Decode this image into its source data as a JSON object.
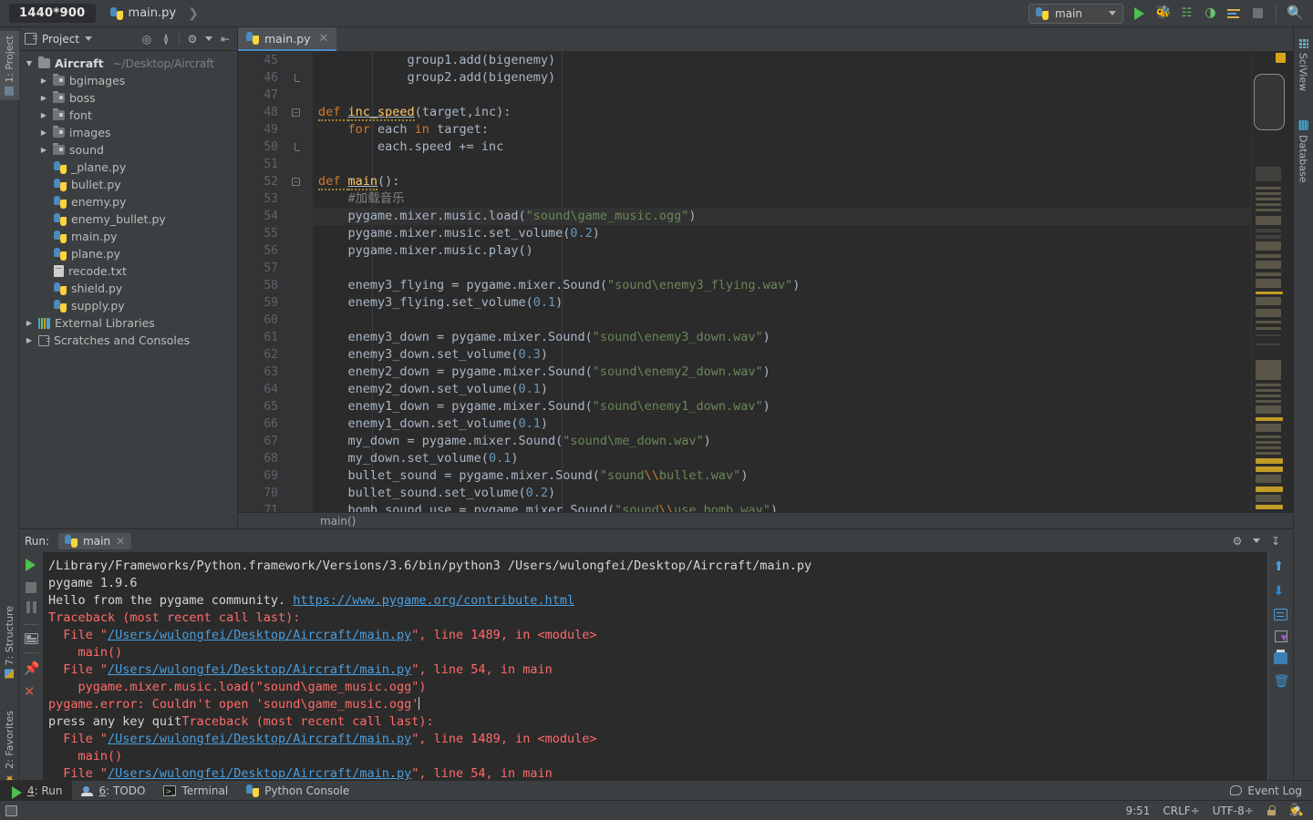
{
  "titlebar": {
    "resolution_badge": "1440*900",
    "breadcrumb_file": "main.py",
    "run_config": "main",
    "icons": [
      "run-icon",
      "debug-icon",
      "coverage-icon",
      "profile-icon",
      "console-icon",
      "stop-icon",
      "search-everywhere-icon"
    ]
  },
  "left_tool_strip": {
    "project_tab": "1: Project",
    "structure_tab": "7: Structure",
    "favorites_tab": "2: Favorites"
  },
  "right_tool_strip": {
    "sciview_tab": "SciView",
    "database_tab": "Database"
  },
  "project_panel": {
    "title": "Project",
    "root": {
      "name": "Aircraft",
      "path": "~/Desktop/Aircraft"
    },
    "items": [
      {
        "label": "bgimages",
        "type": "folder",
        "indent": 1,
        "expanded": false
      },
      {
        "label": "boss",
        "type": "folder",
        "indent": 1,
        "expanded": false
      },
      {
        "label": "font",
        "type": "folder",
        "indent": 1,
        "expanded": false
      },
      {
        "label": "images",
        "type": "folder",
        "indent": 1,
        "expanded": false
      },
      {
        "label": "sound",
        "type": "folder",
        "indent": 1,
        "expanded": false
      },
      {
        "label": "_plane.py",
        "type": "python",
        "indent": 2
      },
      {
        "label": "bullet.py",
        "type": "python",
        "indent": 2
      },
      {
        "label": "enemy.py",
        "type": "python",
        "indent": 2
      },
      {
        "label": "enemy_bullet.py",
        "type": "python",
        "indent": 2
      },
      {
        "label": "main.py",
        "type": "python",
        "indent": 2
      },
      {
        "label": "plane.py",
        "type": "python",
        "indent": 2
      },
      {
        "label": "recode.txt",
        "type": "text",
        "indent": 2
      },
      {
        "label": "shield.py",
        "type": "python",
        "indent": 2
      },
      {
        "label": "supply.py",
        "type": "python",
        "indent": 2
      }
    ],
    "external_libraries": "External Libraries",
    "scratches": "Scratches and Consoles"
  },
  "editor": {
    "tab_label": "main.py",
    "breadcrumb": "main()",
    "first_line_number": 45,
    "highlighted_line": 54,
    "lines": [
      {
        "n": 45,
        "tokens": [
          {
            "t": "            group1.add(bigenemy)",
            "c": "pl"
          }
        ]
      },
      {
        "n": 46,
        "fold": "half",
        "tokens": [
          {
            "t": "            group2.add(bigenemy)",
            "c": "pl"
          }
        ]
      },
      {
        "n": 47,
        "tokens": [
          {
            "t": "",
            "c": "pl"
          }
        ]
      },
      {
        "n": 48,
        "fold": "minus",
        "tokens": [
          {
            "t": "def ",
            "c": "kw squig"
          },
          {
            "t": "inc_speed",
            "c": "fn squig def-u"
          },
          {
            "t": "(",
            "c": "pl"
          },
          {
            "t": "target",
            "c": "pl"
          },
          {
            "t": ",",
            "c": "pl"
          },
          {
            "t": "inc",
            "c": "pl"
          },
          {
            "t": "):",
            "c": "pl"
          }
        ]
      },
      {
        "n": 49,
        "tokens": [
          {
            "t": "    ",
            "c": "pl"
          },
          {
            "t": "for ",
            "c": "kw"
          },
          {
            "t": "each ",
            "c": "pl"
          },
          {
            "t": "in ",
            "c": "kw"
          },
          {
            "t": "target:",
            "c": "pl"
          }
        ]
      },
      {
        "n": 50,
        "fold": "half",
        "tokens": [
          {
            "t": "        each.speed += inc",
            "c": "pl"
          }
        ]
      },
      {
        "n": 51,
        "tokens": [
          {
            "t": "",
            "c": "pl"
          }
        ]
      },
      {
        "n": 52,
        "fold": "minus",
        "tokens": [
          {
            "t": "def ",
            "c": "kw squig"
          },
          {
            "t": "main",
            "c": "fn squig def-u"
          },
          {
            "t": "():",
            "c": "pl"
          }
        ]
      },
      {
        "n": 53,
        "tokens": [
          {
            "t": "    ",
            "c": "pl"
          },
          {
            "t": "#加载音乐",
            "c": "cmt"
          }
        ]
      },
      {
        "n": 54,
        "hl": true,
        "tokens": [
          {
            "t": "    pygame.mixer.music.load(",
            "c": "pl"
          },
          {
            "t": "\"sound\\game_music.ogg\"",
            "c": "str"
          },
          {
            "t": ")",
            "c": "pl"
          }
        ]
      },
      {
        "n": 55,
        "tokens": [
          {
            "t": "    pygame.mixer.music.set_volume(",
            "c": "pl"
          },
          {
            "t": "0.2",
            "c": "num"
          },
          {
            "t": ")",
            "c": "pl"
          }
        ]
      },
      {
        "n": 56,
        "tokens": [
          {
            "t": "    pygame.mixer.music.play()",
            "c": "pl"
          }
        ]
      },
      {
        "n": 57,
        "tokens": [
          {
            "t": "",
            "c": "pl"
          }
        ]
      },
      {
        "n": 58,
        "tokens": [
          {
            "t": "    enemy3_flying = pygame.mixer.Sound(",
            "c": "pl"
          },
          {
            "t": "\"sound\\enemy3_flying.wav\"",
            "c": "str"
          },
          {
            "t": ")",
            "c": "pl"
          }
        ]
      },
      {
        "n": 59,
        "tokens": [
          {
            "t": "    enemy3_flying.set_volume(",
            "c": "pl"
          },
          {
            "t": "0.1",
            "c": "num"
          },
          {
            "t": ")",
            "c": "pl"
          }
        ]
      },
      {
        "n": 60,
        "tokens": [
          {
            "t": "",
            "c": "pl"
          }
        ]
      },
      {
        "n": 61,
        "tokens": [
          {
            "t": "    enemy3_down = pygame.mixer.Sound(",
            "c": "pl"
          },
          {
            "t": "\"sound\\enemy3_down.wav\"",
            "c": "str"
          },
          {
            "t": ")",
            "c": "pl"
          }
        ]
      },
      {
        "n": 62,
        "tokens": [
          {
            "t": "    enemy3_down.set_volume(",
            "c": "pl"
          },
          {
            "t": "0.3",
            "c": "num"
          },
          {
            "t": ")",
            "c": "pl"
          }
        ]
      },
      {
        "n": 63,
        "tokens": [
          {
            "t": "    enemy2_down = pygame.mixer.Sound(",
            "c": "pl"
          },
          {
            "t": "\"sound\\enemy2_down.wav\"",
            "c": "str"
          },
          {
            "t": ")",
            "c": "pl"
          }
        ]
      },
      {
        "n": 64,
        "tokens": [
          {
            "t": "    enemy2_down.set_volume(",
            "c": "pl"
          },
          {
            "t": "0.1",
            "c": "num"
          },
          {
            "t": ")",
            "c": "pl"
          }
        ]
      },
      {
        "n": 65,
        "tokens": [
          {
            "t": "    enemy1_down = pygame.mixer.Sound(",
            "c": "pl"
          },
          {
            "t": "\"sound\\enemy1_down.wav\"",
            "c": "str"
          },
          {
            "t": ")",
            "c": "pl"
          }
        ]
      },
      {
        "n": 66,
        "tokens": [
          {
            "t": "    enemy1_down.set_volume(",
            "c": "pl"
          },
          {
            "t": "0.1",
            "c": "num"
          },
          {
            "t": ")",
            "c": "pl"
          }
        ]
      },
      {
        "n": 67,
        "tokens": [
          {
            "t": "    my_down = pygame.mixer.Sound(",
            "c": "pl"
          },
          {
            "t": "\"sound\\me_down.wav\"",
            "c": "str"
          },
          {
            "t": ")",
            "c": "pl"
          }
        ]
      },
      {
        "n": 68,
        "tokens": [
          {
            "t": "    my_down.set_volume(",
            "c": "pl"
          },
          {
            "t": "0.1",
            "c": "num"
          },
          {
            "t": ")",
            "c": "pl"
          }
        ]
      },
      {
        "n": 69,
        "tokens": [
          {
            "t": "    bullet_sound = pygame.mixer.Sound(",
            "c": "pl"
          },
          {
            "t": "\"sound",
            "c": "str"
          },
          {
            "t": "\\\\",
            "c": "esc"
          },
          {
            "t": "bullet.wav\"",
            "c": "str"
          },
          {
            "t": ")",
            "c": "pl"
          }
        ]
      },
      {
        "n": 70,
        "tokens": [
          {
            "t": "    bullet_sound.set_volume(",
            "c": "pl"
          },
          {
            "t": "0.2",
            "c": "num"
          },
          {
            "t": ")",
            "c": "pl"
          }
        ]
      },
      {
        "n": 71,
        "tokens": [
          {
            "t": "    bomb_sound_use = pygame.mixer.Sound(",
            "c": "pl"
          },
          {
            "t": "\"sound",
            "c": "str"
          },
          {
            "t": "\\\\",
            "c": "esc"
          },
          {
            "t": "use_bomb.wav\"",
            "c": "str"
          },
          {
            "t": ")",
            "c": "pl"
          }
        ]
      }
    ]
  },
  "run_panel": {
    "label": "Run:",
    "tab_label": "main",
    "output": [
      {
        "segs": [
          {
            "t": "/Library/Frameworks/Python.framework/Versions/3.6/bin/python3 /Users/wulongfei/Desktop/Aircraft/main.py",
            "c": "pl"
          }
        ]
      },
      {
        "segs": [
          {
            "t": "pygame 1.9.6",
            "c": "pl"
          }
        ]
      },
      {
        "segs": [
          {
            "t": "Hello from the pygame community. ",
            "c": "pl"
          },
          {
            "t": "https://www.pygame.org/contribute.html",
            "c": "lnk"
          }
        ]
      },
      {
        "segs": [
          {
            "t": "Traceback (most recent call last):",
            "c": "err"
          }
        ]
      },
      {
        "segs": [
          {
            "t": "  File \"",
            "c": "err"
          },
          {
            "t": "/Users/wulongfei/Desktop/Aircraft/main.py",
            "c": "lnk"
          },
          {
            "t": "\", line 1489, in <module>",
            "c": "err"
          }
        ]
      },
      {
        "segs": [
          {
            "t": "    main()",
            "c": "err"
          }
        ]
      },
      {
        "segs": [
          {
            "t": "  File \"",
            "c": "err"
          },
          {
            "t": "/Users/wulongfei/Desktop/Aircraft/main.py",
            "c": "lnk"
          },
          {
            "t": "\", line 54, in main",
            "c": "err"
          }
        ]
      },
      {
        "segs": [
          {
            "t": "    pygame.mixer.music.load(\"sound\\game_music.ogg\")",
            "c": "err"
          }
        ]
      },
      {
        "segs": [
          {
            "t": "pygame.error: Couldn't open 'sound\\game_music.ogg'",
            "c": "err"
          },
          {
            "t": "|CARET|",
            "c": "caret"
          }
        ]
      },
      {
        "segs": [
          {
            "t": "press any key quit",
            "c": "pl"
          },
          {
            "t": "Traceback (most recent call last):",
            "c": "err"
          }
        ]
      },
      {
        "segs": [
          {
            "t": "  File \"",
            "c": "err"
          },
          {
            "t": "/Users/wulongfei/Desktop/Aircraft/main.py",
            "c": "lnk"
          },
          {
            "t": "\", line 1489, in <module>",
            "c": "err"
          }
        ]
      },
      {
        "segs": [
          {
            "t": "    main()",
            "c": "err"
          }
        ]
      },
      {
        "segs": [
          {
            "t": "  File \"",
            "c": "err"
          },
          {
            "t": "/Users/wulongfei/Desktop/Aircraft/main.py",
            "c": "lnk"
          },
          {
            "t": "\", line 54, in main",
            "c": "err"
          }
        ]
      }
    ]
  },
  "tool_window_bar": {
    "items": [
      {
        "num": "4",
        "label": ": Run",
        "icon": "run-icon",
        "selected": true
      },
      {
        "num": "6",
        "label": ": TODO",
        "icon": "todo-icon",
        "selected": false
      },
      {
        "num": "",
        "label": "Terminal",
        "icon": "terminal-icon",
        "selected": false
      },
      {
        "num": "",
        "label": "Python Console",
        "icon": "python-icon",
        "selected": false
      }
    ],
    "event_log": "Event Log"
  },
  "statusbar": {
    "cursor_position": "9:51",
    "line_separator": "CRLF",
    "encoding": "UTF-8",
    "lock_icon": "lock-icon",
    "interpreter_icon": "python-interpreter-icon"
  },
  "colors": {
    "bg": "#3c3f41",
    "editor_bg": "#2b2b2b",
    "accent": "#4a88c7",
    "error": "#ff6b68",
    "link": "#4a9fe0",
    "string": "#6a8759",
    "keyword": "#cc7832",
    "number": "#6897bb",
    "function": "#ffc66d",
    "comment": "#808080"
  }
}
